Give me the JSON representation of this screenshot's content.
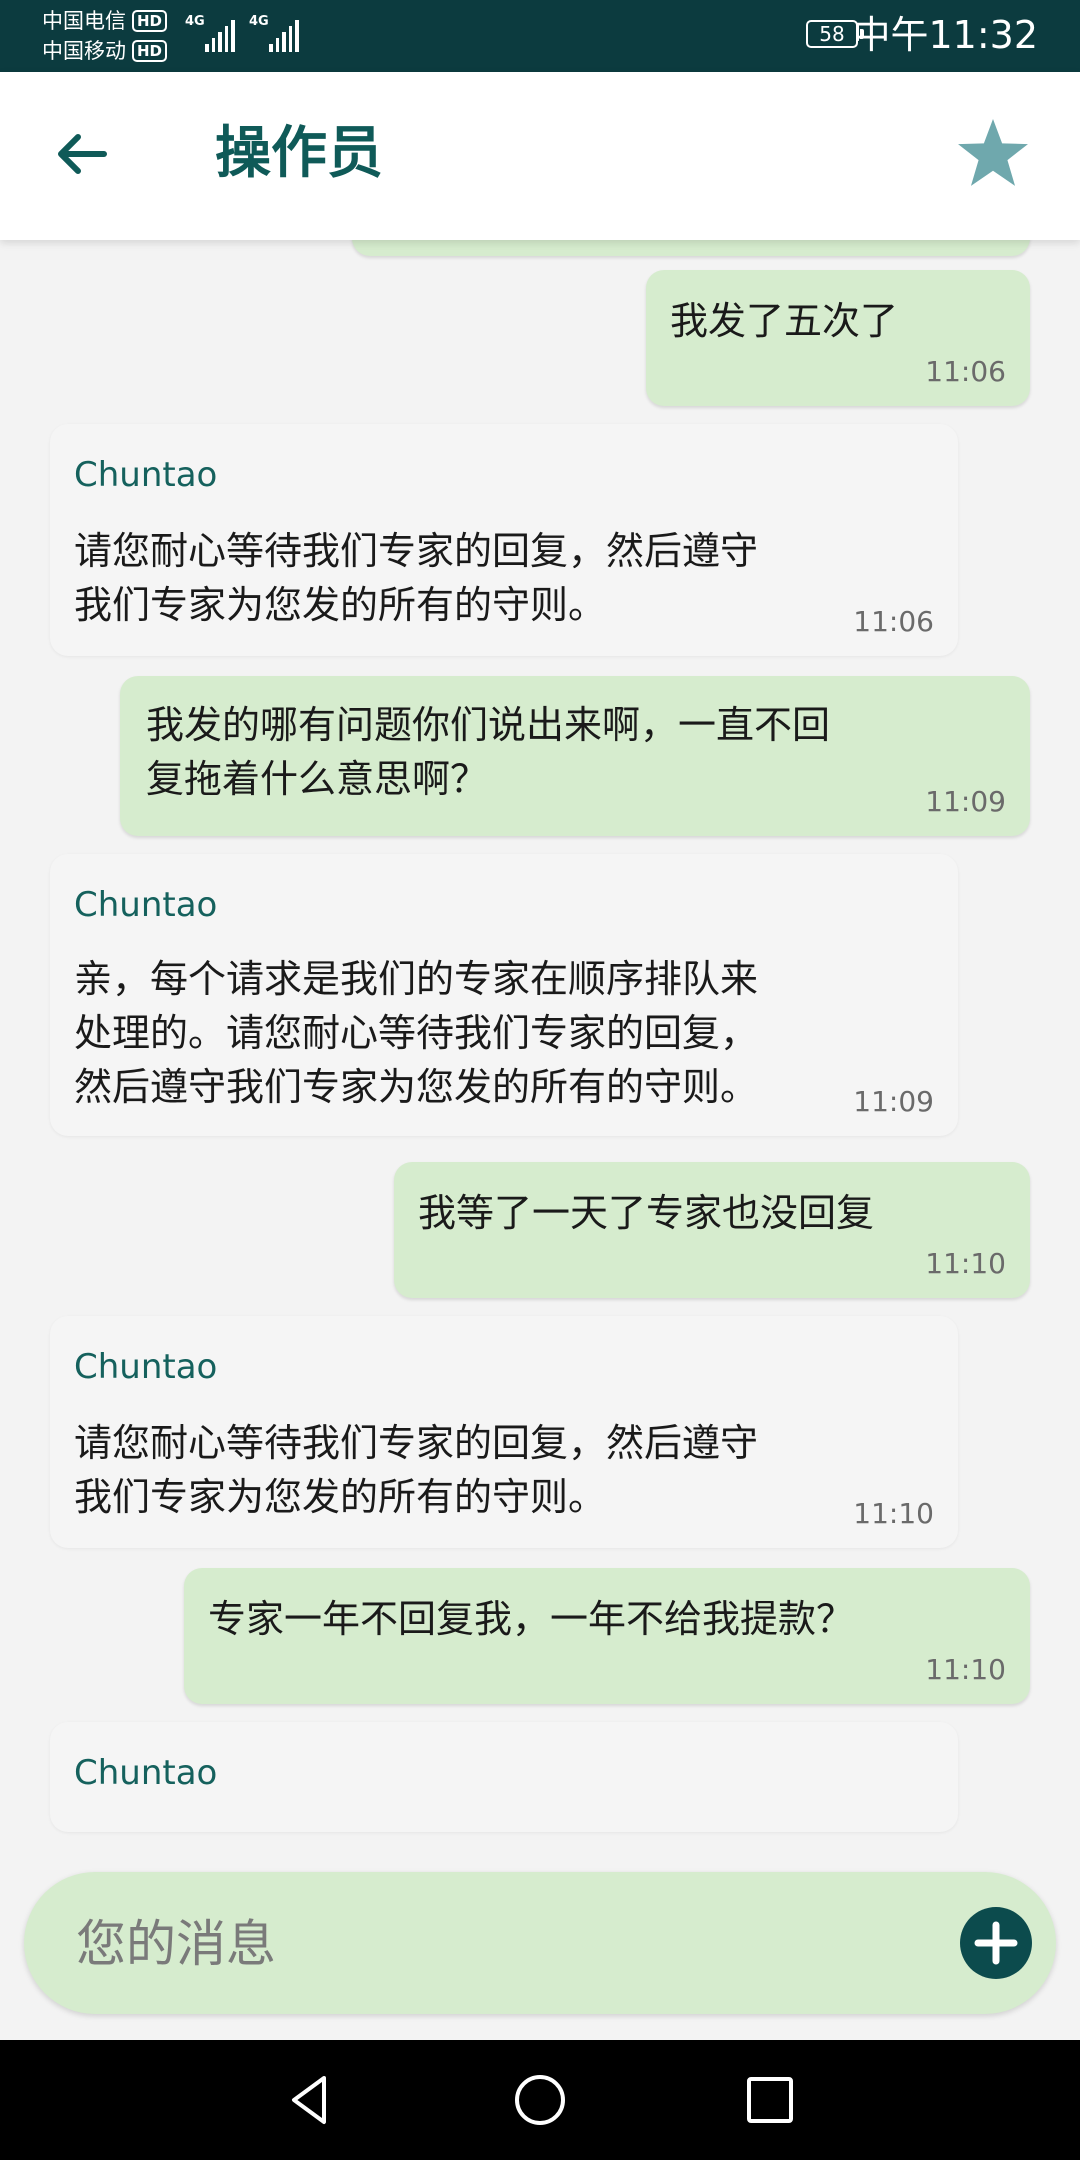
{
  "status_bar": {
    "carrier1": "中国电信",
    "carrier2": "中国移动",
    "hd_label": "HD",
    "network1": "4G",
    "network2": "4G",
    "battery": "58",
    "time": "中午11:32"
  },
  "header": {
    "title": "操作员",
    "back_icon": "arrow-left-icon",
    "star_icon": "star-icon"
  },
  "messages": [
    {
      "type": "outgoing",
      "text": "我发了五次了",
      "time": "11:06"
    },
    {
      "type": "incoming",
      "sender": "Chuntao",
      "text": "请您耐心等待我们专家的回复，然后遵守\n我们专家为您发的所有的守则。",
      "time": "11:06"
    },
    {
      "type": "outgoing",
      "text": "我发的哪有问题你们说出来啊，一直不回\n复拖着什么意思啊？",
      "time": "11:09"
    },
    {
      "type": "incoming",
      "sender": "Chuntao",
      "text": "亲，每个请求是我们的专家在顺序排队来\n处理的。请您耐心等待我们专家的回复，\n然后遵守我们专家为您发的所有的守则。",
      "time": "11:09"
    },
    {
      "type": "outgoing",
      "text": "我等了一天了专家也没回复",
      "time": "11:10"
    },
    {
      "type": "incoming",
      "sender": "Chuntao",
      "text": "请您耐心等待我们专家的回复，然后遵守\n我们专家为您发的所有的守则。",
      "time": "11:10"
    },
    {
      "type": "outgoing",
      "text": "专家一年不回复我，一年不给我提款？",
      "time": "11:10"
    },
    {
      "type": "incoming",
      "sender": "Chuntao"
    }
  ],
  "input": {
    "placeholder": "您的消息",
    "add_icon": "plus-icon"
  },
  "colors": {
    "status_bg": "#0c3b3f",
    "accent": "#0f5a58",
    "outgoing_bubble": "#d6ecce",
    "incoming_bubble": "#f5f5f5",
    "star": "#6fa8ad"
  }
}
